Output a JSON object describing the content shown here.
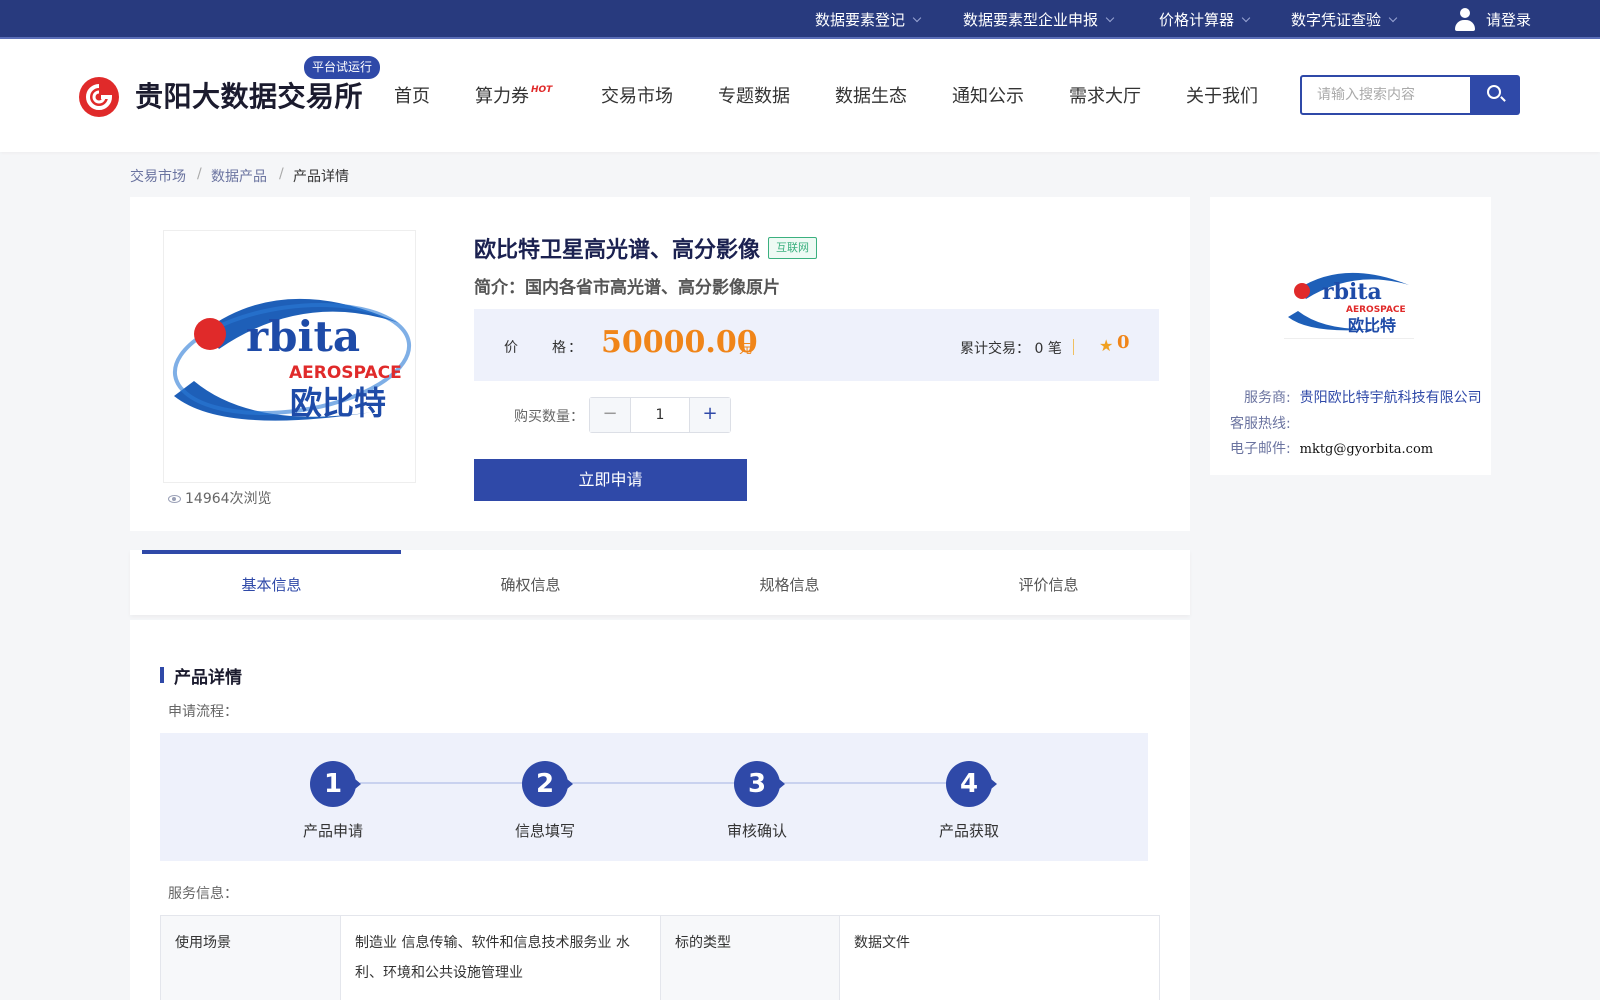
{
  "topbar": {
    "items": [
      "数据要素登记",
      "数据要素型企业申报",
      "价格计算器",
      "数字凭证查验"
    ],
    "login_label": "请登录"
  },
  "header": {
    "brand": "贵阳大数据交易所",
    "trial_badge": "平台试运行",
    "nav": [
      "首页",
      "算力券",
      "交易市场",
      "专题数据",
      "数据生态",
      "通知公示",
      "需求大厅",
      "关于我们"
    ],
    "hot_label": "HOT",
    "search_placeholder": "请输入搜索内容"
  },
  "breadcrumb": [
    "交易市场",
    "数据产品",
    "产品详情"
  ],
  "product": {
    "title": "欧比特卫星高光谱、高分影像",
    "tag": "互联网",
    "intro": "简介：国内各省市高光谱、高分影像原片",
    "price_label": "价　　格：",
    "price": "50000.00",
    "price_unit": "元",
    "trade_label": "累计交易：",
    "trade_count": "0",
    "trade_unit": "笔",
    "rating": "0",
    "quantity_label": "购买数量：",
    "quantity": "1",
    "apply_label": "立即申请",
    "views": "14964次浏览",
    "logo_text": "rbita",
    "logo_sub": "AEROSPACE",
    "logo_cn": "欧比特"
  },
  "provider": {
    "vendor_label": "服务商:",
    "vendor": "贵阳欧比特宇航科技有限公司",
    "hotline_label": "客服热线:",
    "hotline": "",
    "email_label": "电子邮件:",
    "email": "mktg@gyorbita.com"
  },
  "tabs": [
    "基本信息",
    "确权信息",
    "规格信息",
    "评价信息"
  ],
  "details": {
    "section_title": "产品详情",
    "flow_label": "申请流程：",
    "steps": [
      {
        "num": "1",
        "label": "产品申请"
      },
      {
        "num": "2",
        "label": "信息填写"
      },
      {
        "num": "3",
        "label": "审核确认"
      },
      {
        "num": "4",
        "label": "产品获取"
      }
    ],
    "service_label": "服务信息：",
    "table": [
      {
        "k1": "使用场景",
        "v1": "制造业 信息传输、软件和信息技术服务业 水利、环境和公共设施管理业",
        "k2": "标的类型",
        "v2": "数据文件"
      }
    ]
  },
  "colors": {
    "primary": "#2f49a8",
    "topbar": "#283a7e",
    "price": "#f08519",
    "tag": "#3bb07f",
    "brand_red": "#e02a2a"
  }
}
